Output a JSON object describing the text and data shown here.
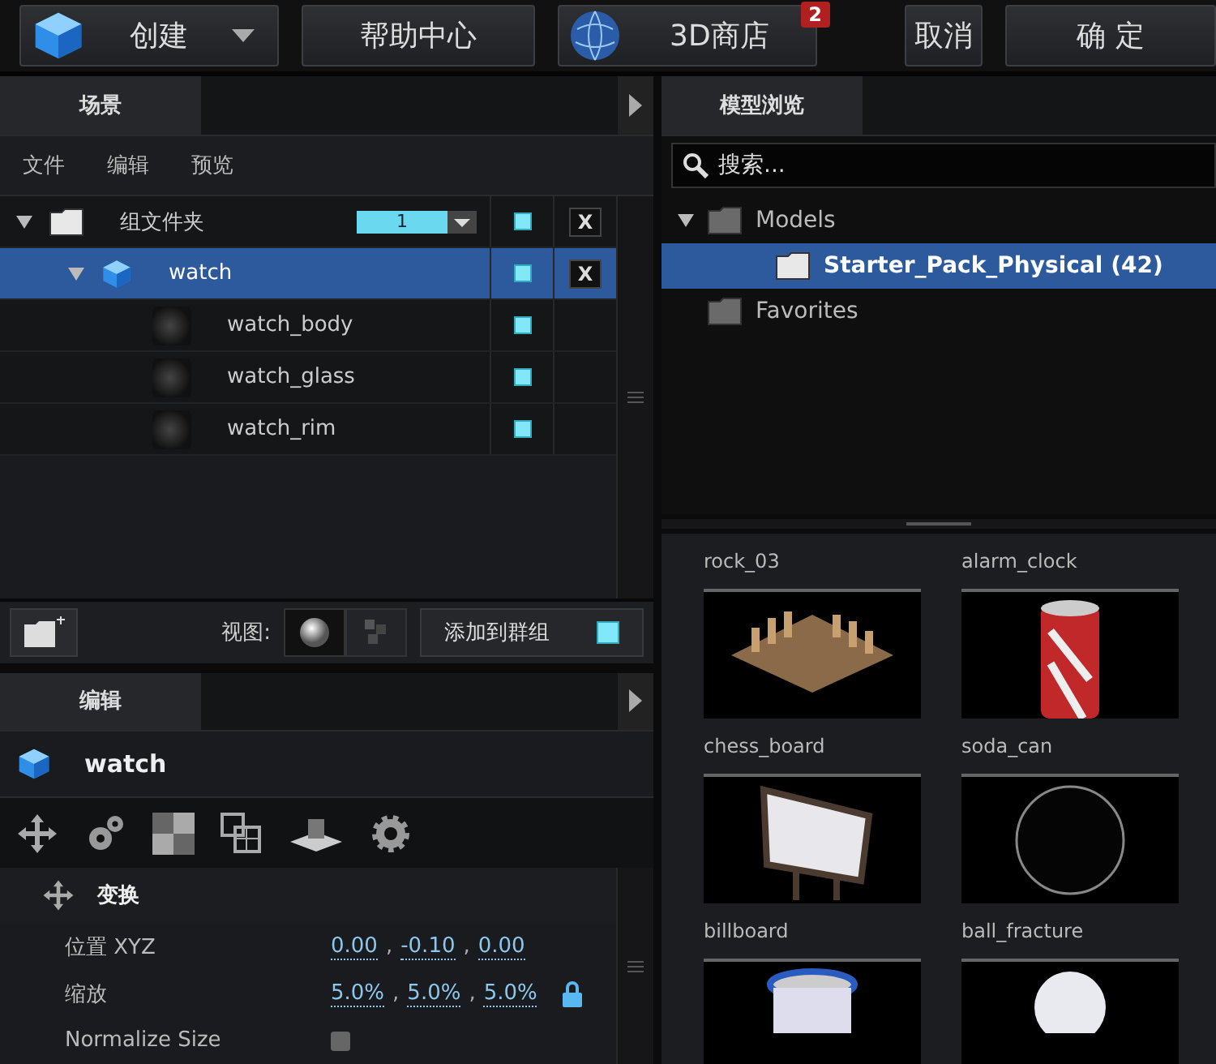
{
  "top_bar": {
    "create": {
      "label": "创建"
    },
    "help": {
      "label": "帮助中心"
    },
    "store": {
      "label": "3D商店",
      "badge": "2"
    },
    "cancel": {
      "label": "取消"
    },
    "ok": {
      "label": "确 定"
    }
  },
  "scene_panel": {
    "tab": "场景",
    "menu": [
      "文件",
      "编辑",
      "预览"
    ],
    "tree": [
      {
        "kind": "group",
        "label": "组文件夹",
        "count": "1",
        "expanded": true,
        "selected": false,
        "visible": true,
        "deletable": true,
        "delete_label": "X",
        "children": [
          {
            "kind": "object",
            "label": "watch",
            "expanded": true,
            "selected": true,
            "visible": true,
            "deletable": true,
            "delete_label": "X",
            "children": [
              {
                "kind": "mesh",
                "label": "watch_body",
                "selected": false,
                "visible": true,
                "deletable": false
              },
              {
                "kind": "mesh",
                "label": "watch_glass",
                "selected": false,
                "visible": true,
                "deletable": false
              },
              {
                "kind": "mesh",
                "label": "watch_rim",
                "selected": false,
                "visible": true,
                "deletable": false
              }
            ]
          }
        ]
      }
    ],
    "toolbar": {
      "view_label": "视图:",
      "view_modes": [
        {
          "kind": "sphere",
          "selected": true
        },
        {
          "kind": "cubes",
          "selected": false
        }
      ],
      "add_to_group": {
        "label": "添加到群组",
        "checked": true
      }
    }
  },
  "edit_panel": {
    "tab": "编辑",
    "object_name": "watch",
    "section": "变换",
    "properties": [
      {
        "kind": "vector",
        "label": "位置 XYZ",
        "values": [
          "0.00",
          "-0.10",
          "0.00"
        ],
        "separators": [
          ",",
          ","
        ],
        "locked": false
      },
      {
        "kind": "vector",
        "label": "缩放",
        "values": [
          "5.0%",
          "5.0%",
          "5.0%"
        ],
        "separators": [
          ",",
          ","
        ],
        "locked": true
      },
      {
        "kind": "checkbox",
        "label": "Normalize Size",
        "checked": false
      }
    ]
  },
  "model_browser": {
    "tab": "模型浏览",
    "search": {
      "placeholder": "搜索..."
    },
    "tree": [
      {
        "label": "Models",
        "expanded": true,
        "selected": false,
        "children": [
          {
            "label": "Starter_Pack_Physical (42)",
            "selected": true
          }
        ]
      },
      {
        "label": "Favorites",
        "selected": false
      }
    ],
    "top_labels": [
      "rock_03",
      "alarm_clock"
    ],
    "items": [
      {
        "kind": "chess",
        "name": "chess_board"
      },
      {
        "kind": "can",
        "name": "soda_can"
      },
      {
        "kind": "billboard",
        "name": "billboard"
      },
      {
        "kind": "sphere",
        "name": "ball_fracture"
      },
      {
        "kind": "bucket"
      },
      {
        "kind": "bulb"
      }
    ]
  }
}
